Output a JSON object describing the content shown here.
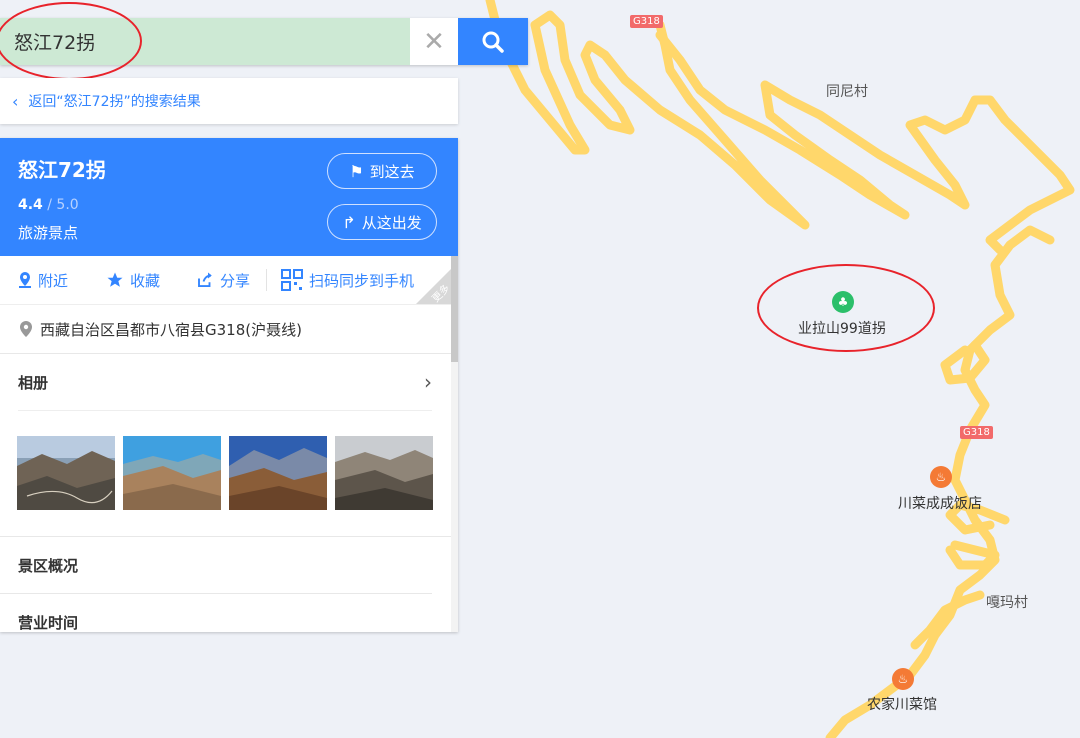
{
  "search": {
    "value": "怒江72拐",
    "clear_icon": "close-icon",
    "button_icon": "search-icon"
  },
  "back": {
    "label": "返回“怒江72拐”的搜索结果"
  },
  "place": {
    "title": "怒江72拐",
    "rating_score": "4.4",
    "rating_max": " / 5.0",
    "category": "旅游景点",
    "goto_label": "到这去",
    "from_label": "从这出发"
  },
  "actions": {
    "nearby": "附近",
    "favorite": "收藏",
    "share": "分享",
    "sync": "扫码同步到手机",
    "more": "更多"
  },
  "address": "西藏自治区昌都市八宿县G318(沪聂线)",
  "album": {
    "title": "相册",
    "arrow": "›"
  },
  "sections": {
    "overview": "景区概况",
    "hours": "营业时间"
  },
  "map": {
    "labels": {
      "tongni": "同尼村",
      "yela": "业拉山99道拐",
      "restaurant1": "川菜成成饭店",
      "gama": "嘎玛村",
      "restaurant2": "农家川菜馆"
    },
    "shields": {
      "s1": "G318",
      "s2": "G318"
    }
  },
  "colors": {
    "accent": "#3385ff",
    "road": "#ffd76b",
    "annotation": "#e8232b"
  }
}
